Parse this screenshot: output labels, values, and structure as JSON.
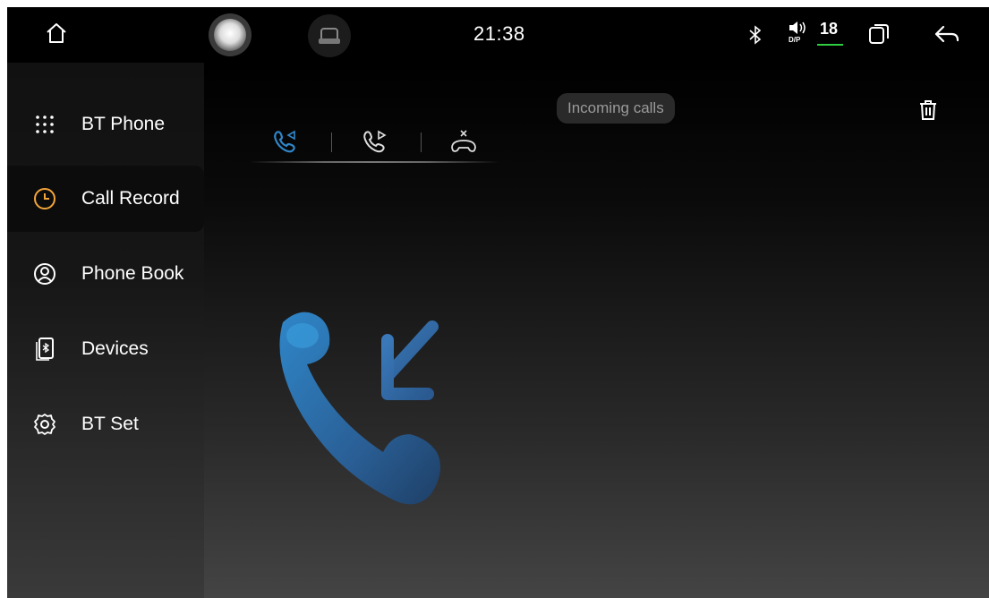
{
  "statusbar": {
    "time": "21:38",
    "volume_level": "18",
    "volume_mode": "D/P",
    "icons": [
      "home-icon",
      "assistant-orb-icon",
      "car-icon",
      "bluetooth-icon",
      "speaker-icon",
      "recent-apps-icon",
      "back-icon"
    ]
  },
  "sidebar": {
    "items": [
      {
        "label": "BT Phone",
        "icon": "dialpad-icon",
        "active": false
      },
      {
        "label": "Call Record",
        "icon": "clock-icon",
        "active": true
      },
      {
        "label": "Phone Book",
        "icon": "contact-icon",
        "active": false
      },
      {
        "label": "Devices",
        "icon": "bluetooth-device-icon",
        "active": false
      },
      {
        "label": "BT Set",
        "icon": "settings-icon",
        "active": false
      }
    ]
  },
  "main": {
    "tabs": [
      {
        "icon": "incoming-call-icon",
        "selected": true
      },
      {
        "icon": "outgoing-call-icon",
        "selected": false
      },
      {
        "icon": "missed-call-icon",
        "selected": false
      }
    ],
    "filter_label": "Incoming calls",
    "empty_state_icon": "incoming-call-illustration"
  },
  "colors": {
    "accent_orange": "#f4a53a",
    "accent_blue": "#2f86c8",
    "volume_underline": "#2ecc40"
  }
}
